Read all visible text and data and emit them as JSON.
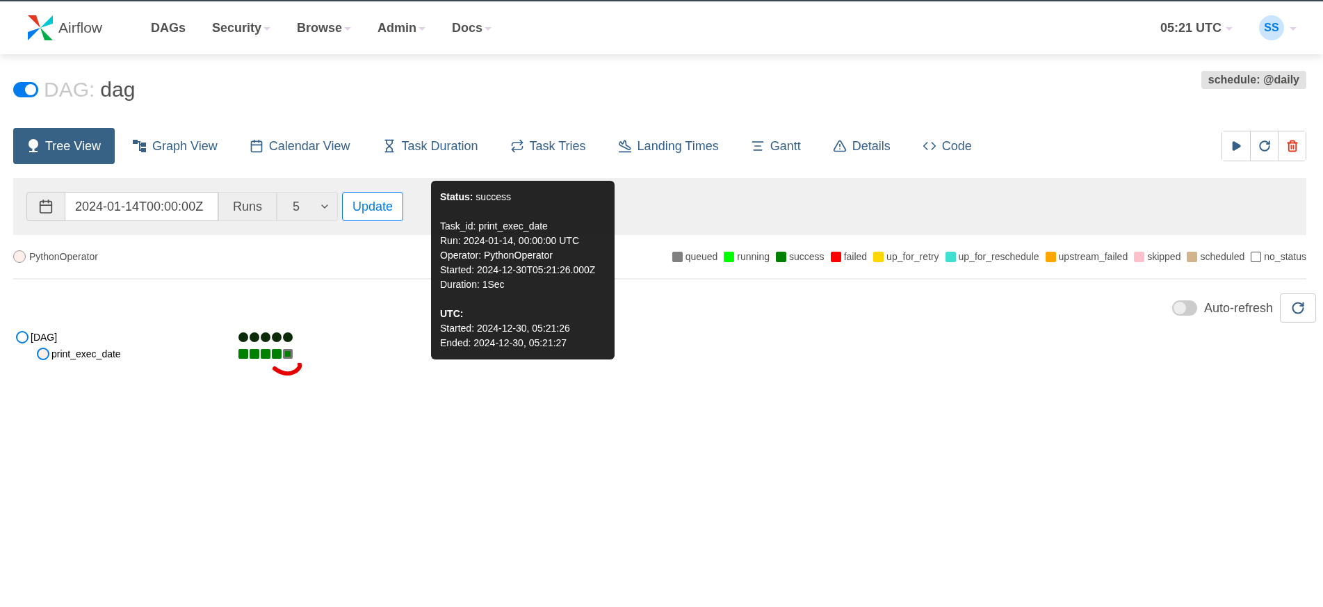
{
  "navbar": {
    "brand": "Airflow",
    "items": [
      {
        "label": "DAGs",
        "dropdown": false
      },
      {
        "label": "Security",
        "dropdown": true
      },
      {
        "label": "Browse",
        "dropdown": true
      },
      {
        "label": "Admin",
        "dropdown": true
      },
      {
        "label": "Docs",
        "dropdown": true
      }
    ],
    "clock": "05:21 UTC",
    "user_initials": "SS"
  },
  "dag": {
    "paused_toggle_on": true,
    "prefix": "DAG:",
    "name": "dag",
    "schedule": "schedule: @daily"
  },
  "view_tabs": [
    {
      "label": "Tree View",
      "selected": true
    },
    {
      "label": "Graph View",
      "selected": false
    },
    {
      "label": "Calendar View",
      "selected": false
    },
    {
      "label": "Task Duration",
      "selected": false
    },
    {
      "label": "Task Tries",
      "selected": false
    },
    {
      "label": "Landing Times",
      "selected": false
    },
    {
      "label": "Gantt",
      "selected": false
    },
    {
      "label": "Details",
      "selected": false
    },
    {
      "label": "Code",
      "selected": false
    }
  ],
  "filter": {
    "base_date": "2024-01-14T00:00:00Z",
    "runs_label": "Runs",
    "runs_value": "5",
    "button": "Update"
  },
  "operators": [
    {
      "name": "PythonOperator",
      "color": "#ffefeb"
    }
  ],
  "legend": [
    {
      "label": "queued",
      "color": "#808080"
    },
    {
      "label": "running",
      "color": "#00ff00"
    },
    {
      "label": "success",
      "color": "#008000"
    },
    {
      "label": "failed",
      "color": "#ff0000"
    },
    {
      "label": "up_for_retry",
      "color": "#ffd700"
    },
    {
      "label": "up_for_reschedule",
      "color": "#40e0d0"
    },
    {
      "label": "upstream_failed",
      "color": "#ffa500"
    },
    {
      "label": "skipped",
      "color": "#ffc0cb"
    },
    {
      "label": "scheduled",
      "color": "#d2b48c"
    },
    {
      "label": "no_status",
      "color": "#ffffff"
    }
  ],
  "auto_refresh": {
    "label": "Auto-refresh",
    "on": false
  },
  "tree": {
    "root": "[DAG]",
    "tasks": [
      {
        "name": "print_exec_date",
        "runs": [
          {
            "color": "#008000",
            "selected": false
          },
          {
            "color": "#008000",
            "selected": false
          },
          {
            "color": "#008000",
            "selected": false
          },
          {
            "color": "#008000",
            "selected": false
          },
          {
            "color": "#008000",
            "selected": true
          }
        ]
      }
    ]
  },
  "tooltip": {
    "status_label": "Status:",
    "status": "success",
    "lines": [
      "Task_id: print_exec_date",
      "Run: 2024-01-14, 00:00:00 UTC",
      "Operator: PythonOperator",
      "Started: 2024-12-30T05:21:26.000Z",
      "Duration: 1Sec"
    ],
    "utc_label": "UTC:",
    "utc_lines": [
      "Started: 2024-12-30, 05:21:26",
      "Ended: 2024-12-30, 05:21:27"
    ]
  }
}
